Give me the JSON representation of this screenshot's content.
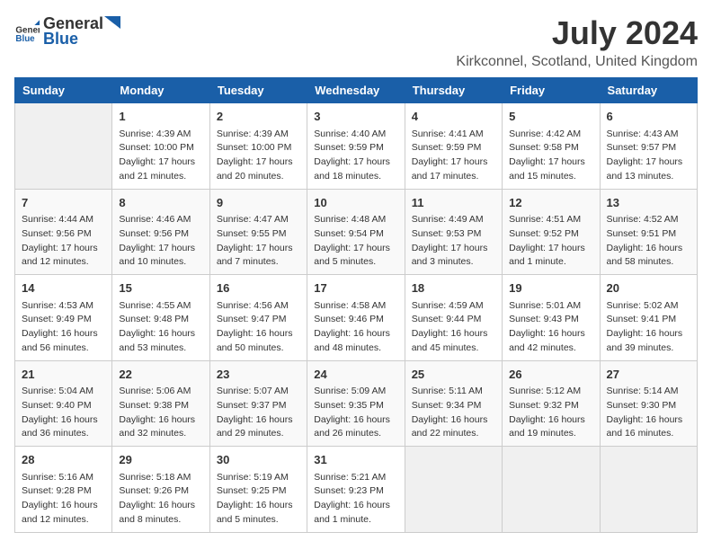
{
  "header": {
    "logo_general": "General",
    "logo_blue": "Blue",
    "title": "July 2024",
    "location": "Kirkconnel, Scotland, United Kingdom"
  },
  "days_of_week": [
    "Sunday",
    "Monday",
    "Tuesday",
    "Wednesday",
    "Thursday",
    "Friday",
    "Saturday"
  ],
  "weeks": [
    [
      {
        "day": "",
        "content": ""
      },
      {
        "day": "1",
        "content": "Sunrise: 4:39 AM\nSunset: 10:00 PM\nDaylight: 17 hours and 21 minutes."
      },
      {
        "day": "2",
        "content": "Sunrise: 4:39 AM\nSunset: 10:00 PM\nDaylight: 17 hours and 20 minutes."
      },
      {
        "day": "3",
        "content": "Sunrise: 4:40 AM\nSunset: 9:59 PM\nDaylight: 17 hours and 18 minutes."
      },
      {
        "day": "4",
        "content": "Sunrise: 4:41 AM\nSunset: 9:59 PM\nDaylight: 17 hours and 17 minutes."
      },
      {
        "day": "5",
        "content": "Sunrise: 4:42 AM\nSunset: 9:58 PM\nDaylight: 17 hours and 15 minutes."
      },
      {
        "day": "6",
        "content": "Sunrise: 4:43 AM\nSunset: 9:57 PM\nDaylight: 17 hours and 13 minutes."
      }
    ],
    [
      {
        "day": "7",
        "content": "Sunrise: 4:44 AM\nSunset: 9:56 PM\nDaylight: 17 hours and 12 minutes."
      },
      {
        "day": "8",
        "content": "Sunrise: 4:46 AM\nSunset: 9:56 PM\nDaylight: 17 hours and 10 minutes."
      },
      {
        "day": "9",
        "content": "Sunrise: 4:47 AM\nSunset: 9:55 PM\nDaylight: 17 hours and 7 minutes."
      },
      {
        "day": "10",
        "content": "Sunrise: 4:48 AM\nSunset: 9:54 PM\nDaylight: 17 hours and 5 minutes."
      },
      {
        "day": "11",
        "content": "Sunrise: 4:49 AM\nSunset: 9:53 PM\nDaylight: 17 hours and 3 minutes."
      },
      {
        "day": "12",
        "content": "Sunrise: 4:51 AM\nSunset: 9:52 PM\nDaylight: 17 hours and 1 minute."
      },
      {
        "day": "13",
        "content": "Sunrise: 4:52 AM\nSunset: 9:51 PM\nDaylight: 16 hours and 58 minutes."
      }
    ],
    [
      {
        "day": "14",
        "content": "Sunrise: 4:53 AM\nSunset: 9:49 PM\nDaylight: 16 hours and 56 minutes."
      },
      {
        "day": "15",
        "content": "Sunrise: 4:55 AM\nSunset: 9:48 PM\nDaylight: 16 hours and 53 minutes."
      },
      {
        "day": "16",
        "content": "Sunrise: 4:56 AM\nSunset: 9:47 PM\nDaylight: 16 hours and 50 minutes."
      },
      {
        "day": "17",
        "content": "Sunrise: 4:58 AM\nSunset: 9:46 PM\nDaylight: 16 hours and 48 minutes."
      },
      {
        "day": "18",
        "content": "Sunrise: 4:59 AM\nSunset: 9:44 PM\nDaylight: 16 hours and 45 minutes."
      },
      {
        "day": "19",
        "content": "Sunrise: 5:01 AM\nSunset: 9:43 PM\nDaylight: 16 hours and 42 minutes."
      },
      {
        "day": "20",
        "content": "Sunrise: 5:02 AM\nSunset: 9:41 PM\nDaylight: 16 hours and 39 minutes."
      }
    ],
    [
      {
        "day": "21",
        "content": "Sunrise: 5:04 AM\nSunset: 9:40 PM\nDaylight: 16 hours and 36 minutes."
      },
      {
        "day": "22",
        "content": "Sunrise: 5:06 AM\nSunset: 9:38 PM\nDaylight: 16 hours and 32 minutes."
      },
      {
        "day": "23",
        "content": "Sunrise: 5:07 AM\nSunset: 9:37 PM\nDaylight: 16 hours and 29 minutes."
      },
      {
        "day": "24",
        "content": "Sunrise: 5:09 AM\nSunset: 9:35 PM\nDaylight: 16 hours and 26 minutes."
      },
      {
        "day": "25",
        "content": "Sunrise: 5:11 AM\nSunset: 9:34 PM\nDaylight: 16 hours and 22 minutes."
      },
      {
        "day": "26",
        "content": "Sunrise: 5:12 AM\nSunset: 9:32 PM\nDaylight: 16 hours and 19 minutes."
      },
      {
        "day": "27",
        "content": "Sunrise: 5:14 AM\nSunset: 9:30 PM\nDaylight: 16 hours and 16 minutes."
      }
    ],
    [
      {
        "day": "28",
        "content": "Sunrise: 5:16 AM\nSunset: 9:28 PM\nDaylight: 16 hours and 12 minutes."
      },
      {
        "day": "29",
        "content": "Sunrise: 5:18 AM\nSunset: 9:26 PM\nDaylight: 16 hours and 8 minutes."
      },
      {
        "day": "30",
        "content": "Sunrise: 5:19 AM\nSunset: 9:25 PM\nDaylight: 16 hours and 5 minutes."
      },
      {
        "day": "31",
        "content": "Sunrise: 5:21 AM\nSunset: 9:23 PM\nDaylight: 16 hours and 1 minute."
      },
      {
        "day": "",
        "content": ""
      },
      {
        "day": "",
        "content": ""
      },
      {
        "day": "",
        "content": ""
      }
    ]
  ]
}
